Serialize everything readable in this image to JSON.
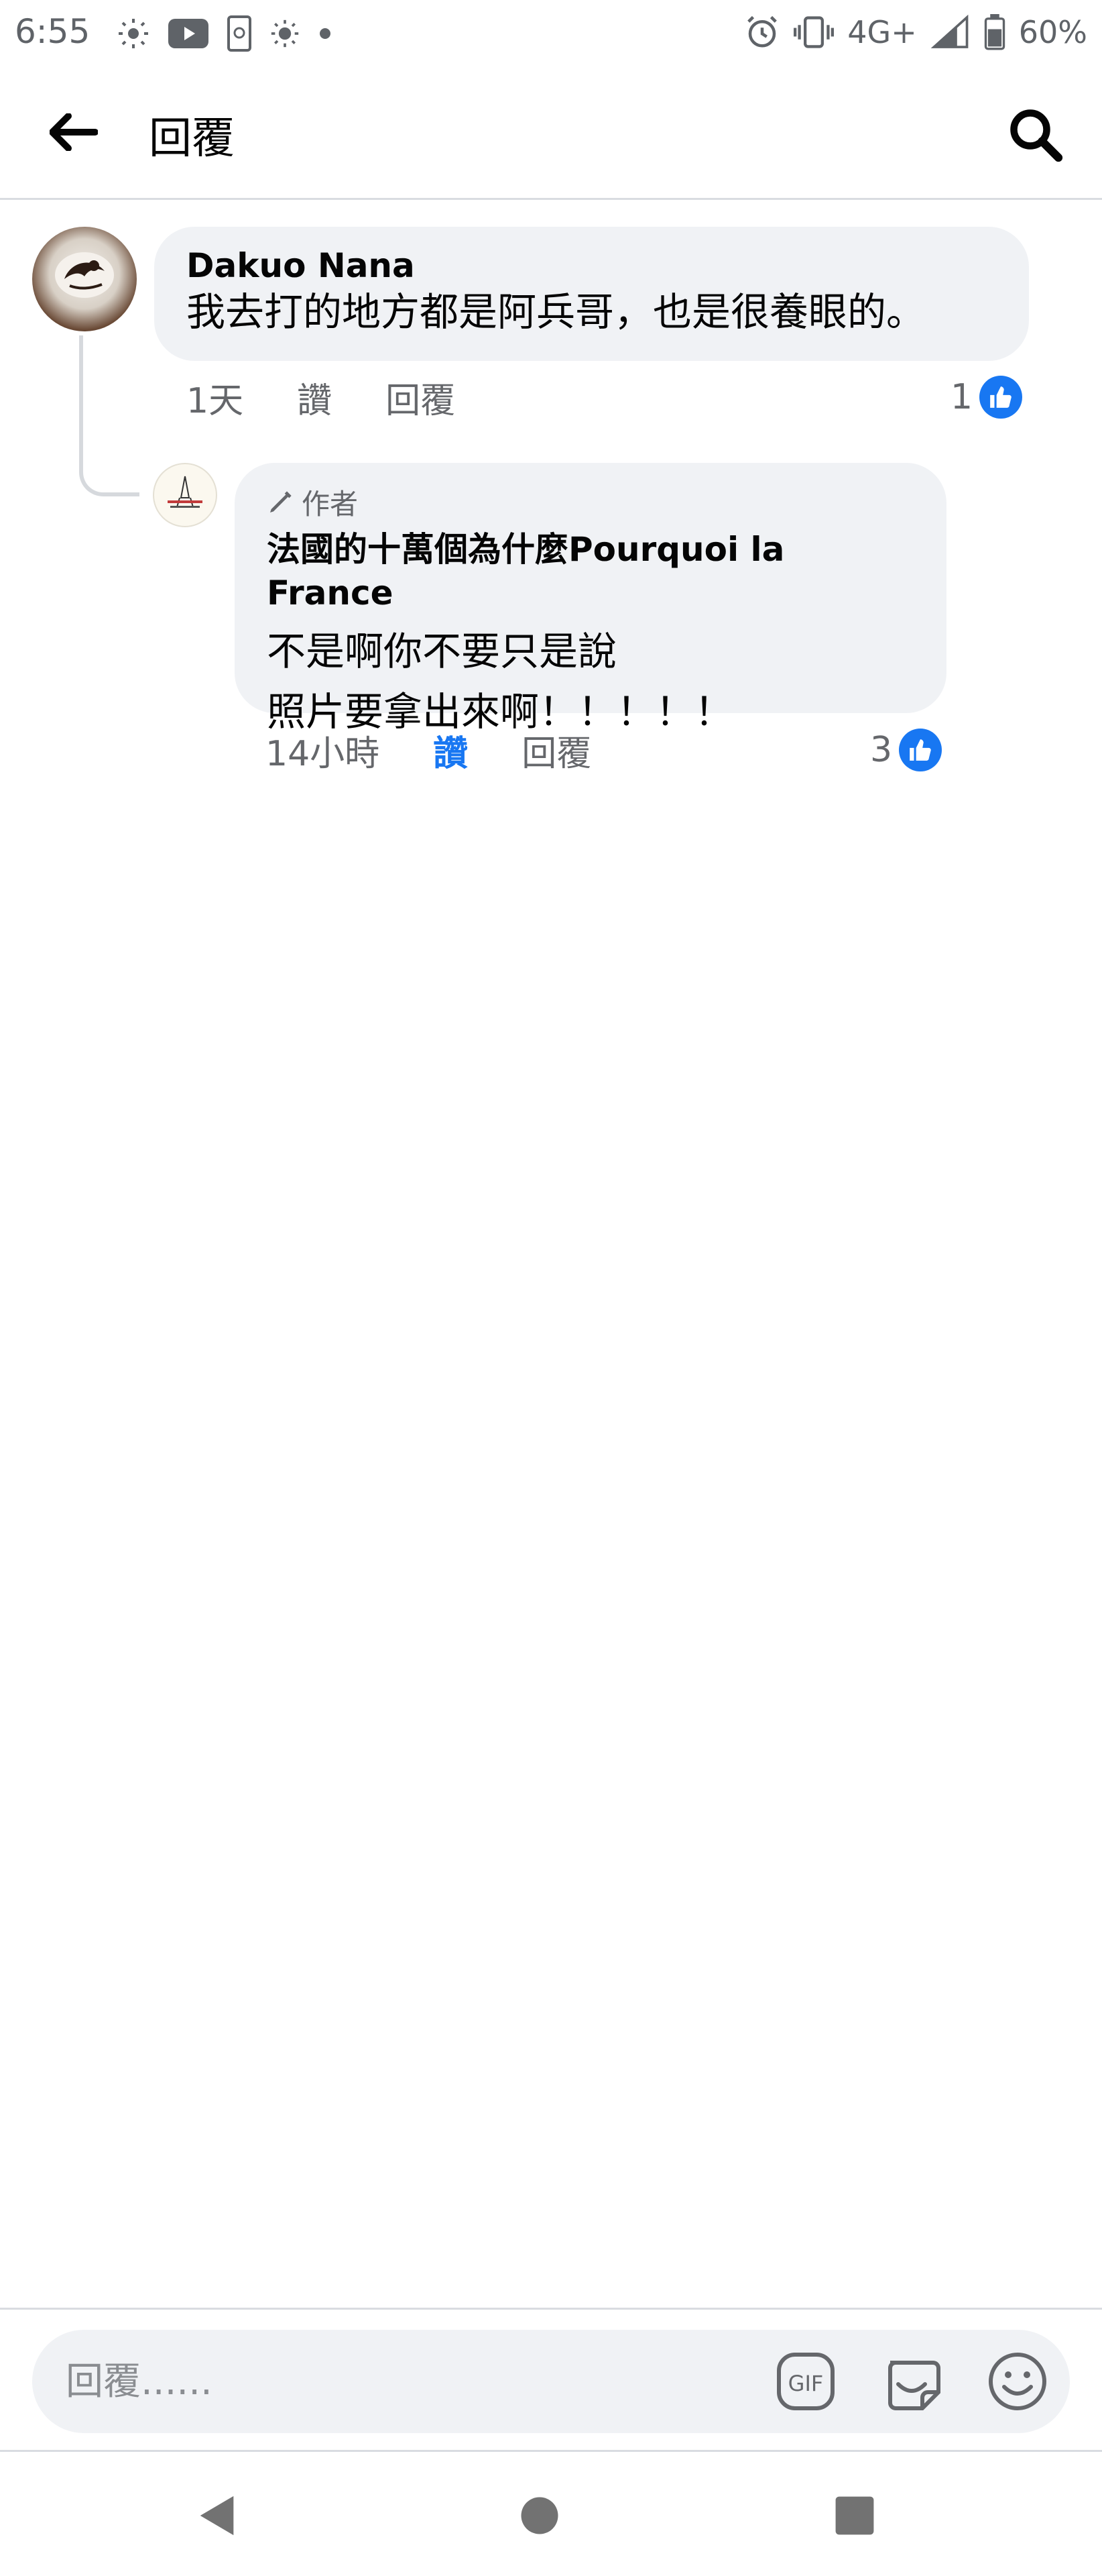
{
  "status_bar": {
    "time": "6:55",
    "network": "4G+",
    "battery": "60%",
    "icons_left": [
      "brightness-icon",
      "youtube-icon",
      "screen-record-icon",
      "brightness-icon",
      "dot-icon"
    ],
    "icons_right": [
      "alarm-icon",
      "vibrate-icon",
      "signal-icon",
      "battery-icon"
    ]
  },
  "app_bar": {
    "title": "回覆"
  },
  "comments": [
    {
      "author": "Dakuo Nana",
      "text": "我去打的地方都是阿兵哥，也是很養眼的。",
      "time": "1天",
      "like_label": "讚",
      "reply_label": "回覆",
      "reactions_count": "1",
      "liked": false
    },
    {
      "author_badge": "作者",
      "author": "法國的十萬個為什麼Pourquoi la France",
      "lines": [
        "不是啊你不要只是說",
        "照片要拿出來啊！！！！！"
      ],
      "time": "14小時",
      "like_label": "讚",
      "reply_label": "回覆",
      "reactions_count": "3",
      "liked": true
    }
  ],
  "composer": {
    "placeholder": "回覆......",
    "gif_label": "GIF"
  },
  "colors": {
    "accent": "#1877f2",
    "bubble": "#f0f2f5",
    "secondary_text": "#65676b"
  }
}
